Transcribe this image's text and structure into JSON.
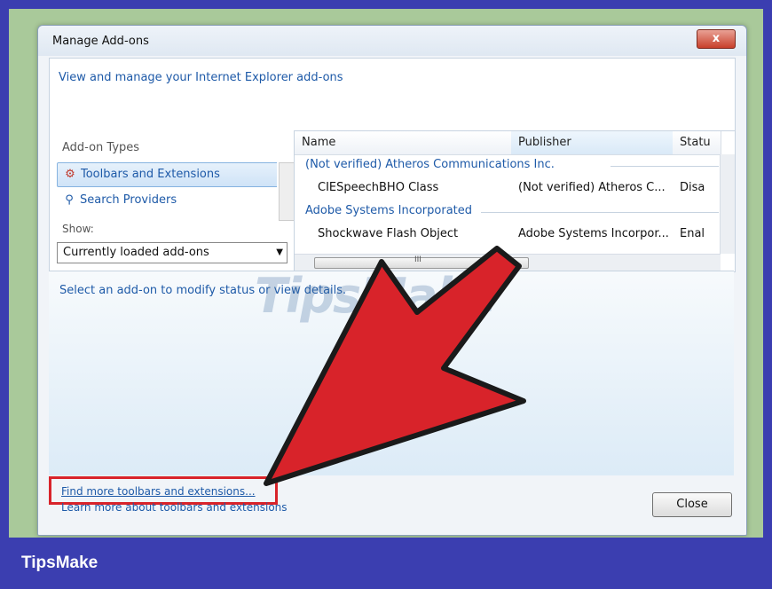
{
  "window": {
    "title": "Manage Add-ons",
    "close_glyph": "x"
  },
  "header": {
    "link": "View and manage your Internet Explorer add-ons"
  },
  "left": {
    "types_label": "Add-on Types",
    "types": [
      {
        "label": "Toolbars and Extensions",
        "icon": "gear-icon",
        "selected": true
      },
      {
        "label": "Search Providers",
        "icon": "search-icon",
        "selected": false
      }
    ],
    "show_label": "Show:",
    "show_value": "Currently loaded add-ons"
  },
  "table": {
    "columns": [
      "Name",
      "Publisher",
      "Statu"
    ],
    "groups": [
      {
        "name": "(Not verified) Atheros Communications Inc.",
        "rows": [
          {
            "name": "CIESpeechBHO Class",
            "publisher": "(Not verified) Atheros C...",
            "status": "Disa"
          }
        ]
      },
      {
        "name": "Adobe Systems Incorporated",
        "rows": [
          {
            "name": "Shockwave Flash Object",
            "publisher": "Adobe Systems Incorpor...",
            "status": "Enal"
          }
        ]
      }
    ],
    "scroll_mark": "III"
  },
  "details": {
    "text": "Select an add-on to modify status or view details.",
    "watermark": "TipsMake"
  },
  "footer": {
    "find_link": "Find more toolbars and extensions...",
    "learn_link": "Learn more about toolbars and extensions",
    "close_label": "Close"
  },
  "annotation": {
    "arrow_color": "#d8232a",
    "highlight_color": "#d8232a"
  },
  "brand": {
    "name": "TipsMake",
    "bar_color": "#3b3eb0"
  }
}
